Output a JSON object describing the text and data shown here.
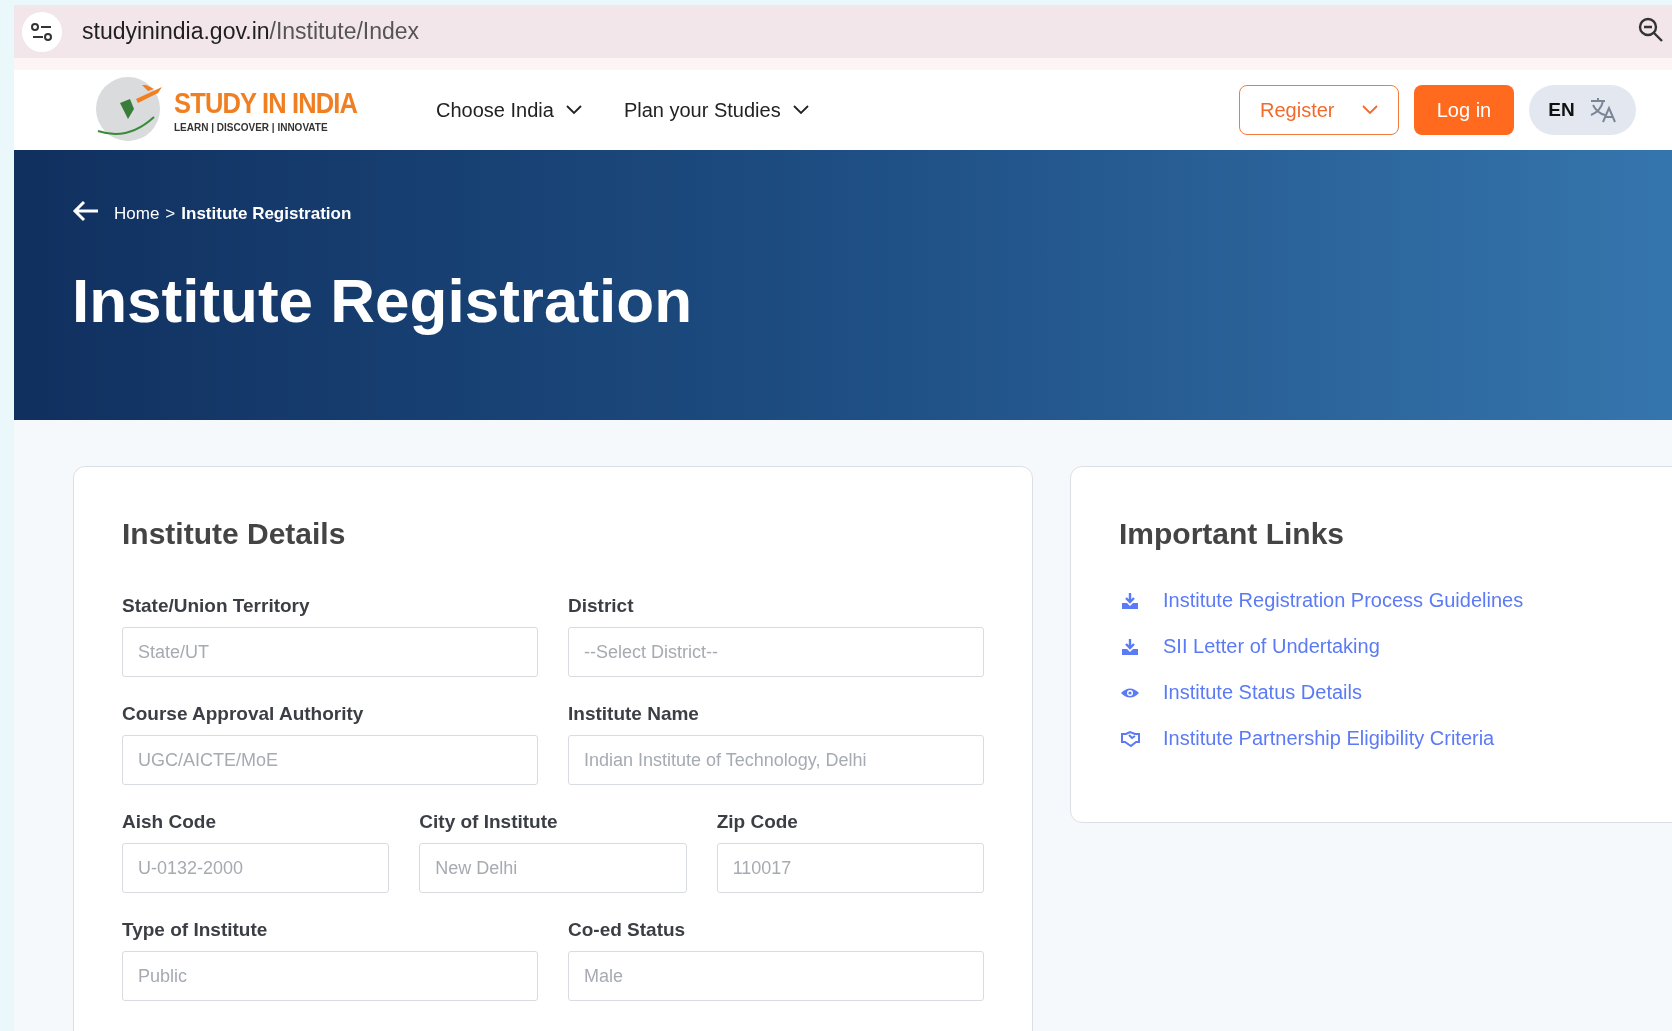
{
  "browser": {
    "url_host": "studyinindia.gov.in",
    "url_path": "/Institute/Index"
  },
  "header": {
    "logo": {
      "title": "STUDY IN INDIA",
      "tagline": "LEARN | DISCOVER | INNOVATE"
    },
    "menus": [
      {
        "label": "Choose India"
      },
      {
        "label": "Plan your Studies"
      }
    ],
    "register": "Register",
    "login": "Log in",
    "language": "EN"
  },
  "breadcrumb": {
    "home": "Home",
    "separator": ">",
    "current": "Institute Registration"
  },
  "page_title": "Institute Registration",
  "form": {
    "title": "Institute Details",
    "rows": [
      [
        {
          "label": "State/Union Territory",
          "placeholder": "State/UT"
        },
        {
          "label": "District",
          "placeholder": "--Select District--"
        }
      ],
      [
        {
          "label": "Course Approval Authority",
          "placeholder": "UGC/AICTE/MoE"
        },
        {
          "label": "Institute Name",
          "placeholder": "Indian Institute of Technology, Delhi"
        }
      ],
      [
        {
          "label": "Aish Code",
          "placeholder": "U-0132-2000"
        },
        {
          "label": "City of Institute",
          "placeholder": "New Delhi"
        },
        {
          "label": "Zip Code",
          "placeholder": "110017"
        }
      ],
      [
        {
          "label": "Type of Institute",
          "placeholder": "Public"
        },
        {
          "label": "Co-ed Status",
          "placeholder": "Male"
        }
      ]
    ]
  },
  "links": {
    "title": "Important Links",
    "items": [
      {
        "kind": "download",
        "label": "Institute Registration Process Guidelines"
      },
      {
        "kind": "download",
        "label": "SII Letter of Undertaking"
      },
      {
        "kind": "view",
        "label": "Institute Status Details"
      },
      {
        "kind": "partnership",
        "label": "Institute Partnership Eligibility Criteria"
      }
    ]
  }
}
